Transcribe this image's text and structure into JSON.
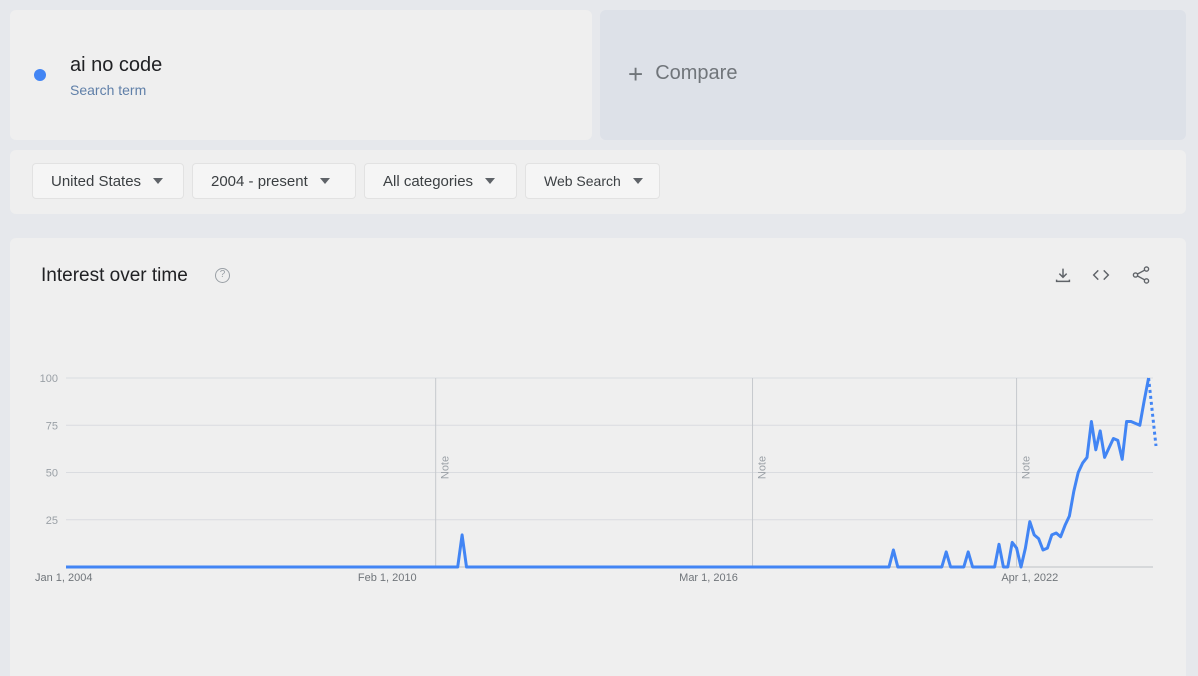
{
  "search_term": {
    "name": "ai no code",
    "type": "Search term",
    "color": "#4285f4"
  },
  "compare": {
    "plus": "+",
    "label": "Compare"
  },
  "filters": {
    "geo": "United States",
    "time": "2004 - present",
    "category": "All categories",
    "property": "Web Search"
  },
  "chart": {
    "title": "Interest over time",
    "help": "?",
    "icons": [
      "download-icon",
      "embed-icon",
      "share-icon"
    ]
  },
  "chart_data": {
    "type": "line",
    "title": "Interest over time",
    "xlabel": "",
    "ylabel": "",
    "ylim": [
      0,
      100
    ],
    "yticks": [
      25,
      50,
      75,
      100
    ],
    "xticks": [
      "Jan 1, 2004",
      "Feb 1, 2010",
      "Mar 1, 2016",
      "Apr 1, 2022"
    ],
    "grid": true,
    "notes": [
      {
        "date": "2011-01",
        "label": "Note"
      },
      {
        "date": "2017-01",
        "label": "Note"
      },
      {
        "date": "2022-01",
        "label": "Note"
      }
    ],
    "series": [
      {
        "color": "#4285f4",
        "points": [
          [
            "2004-01",
            0
          ],
          [
            "2011-06",
            0
          ],
          [
            "2011-07",
            17
          ],
          [
            "2011-08",
            0
          ],
          [
            "2019-08",
            0
          ],
          [
            "2019-09",
            9
          ],
          [
            "2019-10",
            0
          ],
          [
            "2020-08",
            0
          ],
          [
            "2020-09",
            8
          ],
          [
            "2020-10",
            0
          ],
          [
            "2021-01",
            0
          ],
          [
            "2021-02",
            8
          ],
          [
            "2021-03",
            0
          ],
          [
            "2021-08",
            0
          ],
          [
            "2021-09",
            12
          ],
          [
            "2021-10",
            0
          ],
          [
            "2021-11",
            0
          ],
          [
            "2021-12",
            13
          ],
          [
            "2022-01",
            10
          ],
          [
            "2022-02",
            0
          ],
          [
            "2022-03",
            10
          ],
          [
            "2022-04",
            24
          ],
          [
            "2022-05",
            17
          ],
          [
            "2022-06",
            15
          ],
          [
            "2022-07",
            9
          ],
          [
            "2022-08",
            10
          ],
          [
            "2022-09",
            17
          ],
          [
            "2022-10",
            18
          ],
          [
            "2022-11",
            16
          ],
          [
            "2022-12",
            22
          ],
          [
            "2023-01",
            27
          ],
          [
            "2023-02",
            40
          ],
          [
            "2023-03",
            50
          ],
          [
            "2023-04",
            55
          ],
          [
            "2023-05",
            58
          ],
          [
            "2023-06",
            77
          ],
          [
            "2023-07",
            62
          ],
          [
            "2023-08",
            72
          ],
          [
            "2023-09",
            58
          ],
          [
            "2023-10",
            63
          ],
          [
            "2023-11",
            68
          ],
          [
            "2023-12",
            67
          ],
          [
            "2024-01",
            57
          ],
          [
            "2024-02",
            77
          ],
          [
            "2024-03",
            77
          ],
          [
            "2024-04",
            76
          ],
          [
            "2024-05",
            75
          ],
          [
            "2024-06",
            88
          ],
          [
            "2024-07",
            100
          ]
        ],
        "partial": [
          [
            "2024-07",
            100
          ],
          [
            "2024-08",
            64
          ]
        ]
      }
    ]
  }
}
